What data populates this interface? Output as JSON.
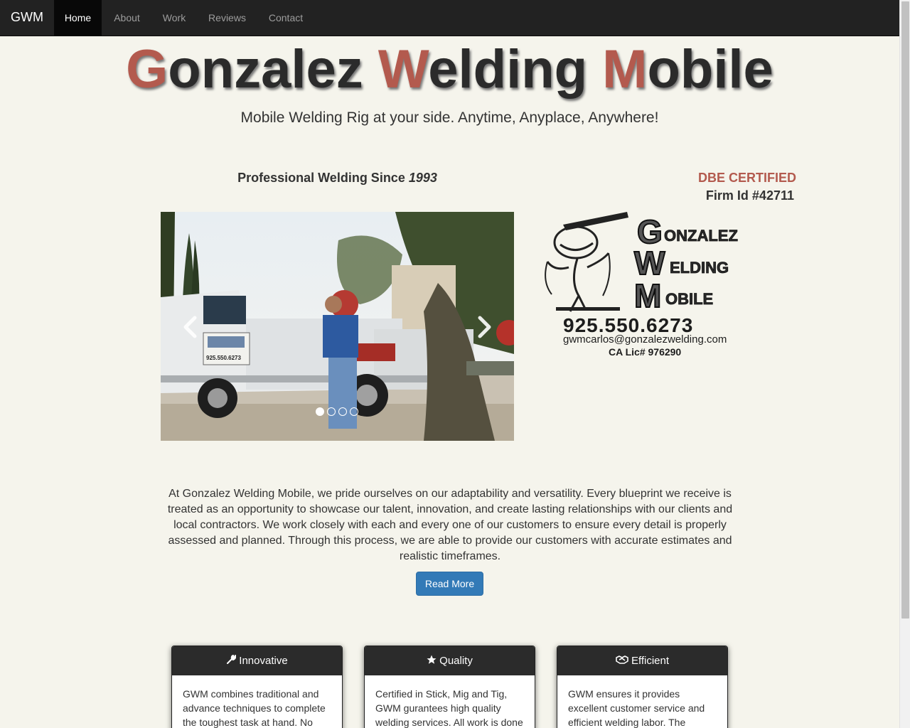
{
  "nav": {
    "brand": "GWM",
    "items": [
      {
        "label": "Home",
        "active": true
      },
      {
        "label": "About",
        "active": false
      },
      {
        "label": "Work",
        "active": false
      },
      {
        "label": "Reviews",
        "active": false
      },
      {
        "label": "Contact",
        "active": false
      }
    ]
  },
  "hero": {
    "title_parts": [
      "G",
      "onzalez ",
      "W",
      "elding ",
      "M",
      "obile"
    ],
    "tagline": "Mobile Welding Rig at your side. Anytime, Anyplace, Anywhere!"
  },
  "since": {
    "text": "Professional Welding Since ",
    "year": "1993"
  },
  "certification": {
    "label": "DBE CERTIFIED",
    "firm_id": "Firm Id #42711"
  },
  "carousel": {
    "prev_icon": "chevron-left-icon",
    "next_icon": "chevron-right-icon",
    "slide_count": 4,
    "active_slide": 1,
    "truck_phone": "925.550.6273"
  },
  "logo": {
    "line1": "ONZALEZ",
    "line2": "ELDING",
    "line3": "OBILE",
    "cap1": "G",
    "cap2": "W",
    "cap3": "M",
    "phone": "925.550.6273",
    "email": "gwmcarlos@gonzalezwelding.com",
    "license": "CA Lic#  976290"
  },
  "intro": {
    "text": "At Gonzalez Welding Mobile, we pride ourselves on our adaptability and versatility. Every blueprint we receive is treated as an opportunity to showcase our talent, innovation, and create lasting relationships with our clients and local contractors. We work closely with each and every one of our customers to ensure every detail is properly assessed and planned. Through this process, we are able to provide our customers with accurate estimates and realistic timeframes.",
    "button": "Read More"
  },
  "cards": [
    {
      "icon": "wrench-icon",
      "title": "Innovative",
      "text": "GWM combines traditional and advance techniques to complete the toughest task at hand. No"
    },
    {
      "icon": "star-icon",
      "title": "Quality",
      "text": "Certified in Stick, Mig and Tig, GWM gurantees high quality welding services. All work is done"
    },
    {
      "icon": "handshake-icon",
      "title": "Efficient",
      "text": "GWM ensures it provides excellent customer service and efficient welding labor. The"
    }
  ],
  "colors": {
    "accent": "#b35a4e",
    "navbar": "#222222",
    "button": "#337ab7",
    "background": "#f5f4ec"
  }
}
